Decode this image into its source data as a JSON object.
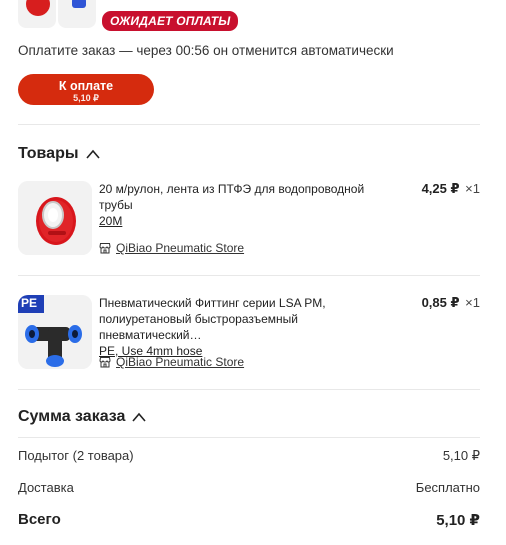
{
  "header": {
    "status_badge": "ОЖИДАЕТ ОПЛАТЫ",
    "countdown_text": "Оплатите заказ — через 00:56 он отменится автоматически",
    "pay_button": {
      "label": "К оплате",
      "amount": "5,10 ₽"
    }
  },
  "products_section": {
    "title": "Товары",
    "items": [
      {
        "title_line": "20 м/рулон, лента из ПТФЭ для водопроводной трубы",
        "title_link": "20M",
        "store": "QiBiao Pneumatic Store",
        "price": "4,25 ₽",
        "qty": "×1"
      },
      {
        "title_line": "Пневматический Фиттинг серии LSA PM, полиуретановый быстроразъемный пневматический…",
        "title_link": "PE, Use 4mm hose",
        "store": "QiBiao Pneumatic Store",
        "price": "0,85 ₽",
        "qty": "×1",
        "thumb_badge": "PE"
      }
    ]
  },
  "summary": {
    "title": "Сумма заказа",
    "subtotal_label": "Подытог (2 товара)",
    "subtotal_value": "5,10 ₽",
    "delivery_label": "Доставка",
    "delivery_value": "Бесплатно",
    "total_label": "Всего",
    "total_value": "5,10 ₽"
  },
  "colors": {
    "accent": "#d52b0e",
    "badge": "#c8102e",
    "divider": "#e8e8e8"
  },
  "icons": [
    "chevron-up-icon",
    "store-icon"
  ]
}
